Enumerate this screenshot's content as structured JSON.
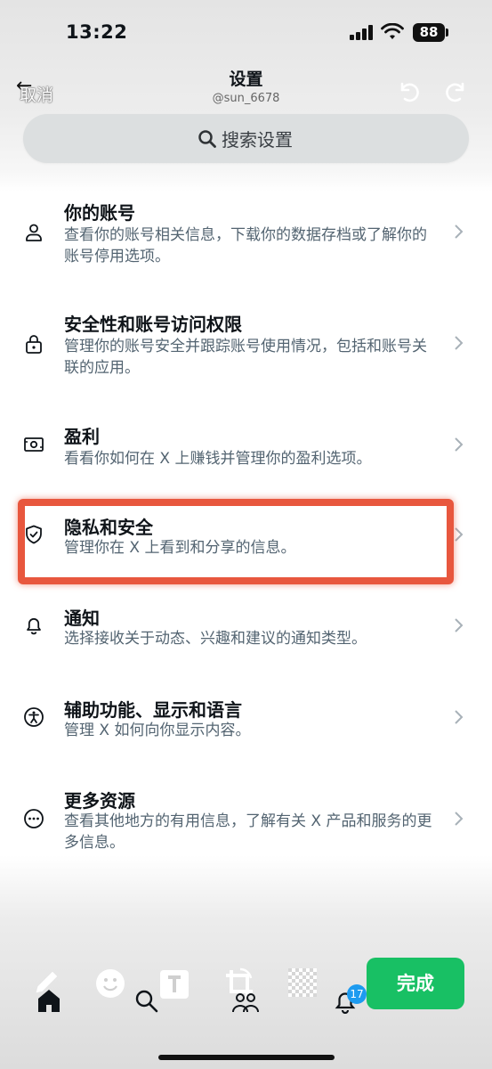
{
  "status": {
    "time": "13:22",
    "battery": "88"
  },
  "header": {
    "cancel_label": "取消",
    "title": "设置",
    "handle": "@sun_6678"
  },
  "search": {
    "placeholder": "搜索设置"
  },
  "items": [
    {
      "title": "你的账号",
      "desc": "查看你的账号相关信息，下载你的数据存档或了解你的账号停用选项。",
      "icon": "person-icon"
    },
    {
      "title": "安全性和账号访问权限",
      "desc": "管理你的账号安全并跟踪账号使用情况，包括和账号关联的应用。",
      "icon": "lock-icon"
    },
    {
      "title": "盈利",
      "desc": "看看你如何在 X 上赚钱并管理你的盈利选项。",
      "icon": "money-icon"
    },
    {
      "title": "隐私和安全",
      "desc": "管理你在 X 上看到和分享的信息。",
      "icon": "shield-icon"
    },
    {
      "title": "通知",
      "desc": "选择接收关于动态、兴趣和建议的通知类型。",
      "icon": "bell-icon"
    },
    {
      "title": "辅助功能、显示和语言",
      "desc": "管理 X 如何向你显示内容。",
      "icon": "accessibility-icon"
    },
    {
      "title": "更多资源",
      "desc": "查看其他地方的有用信息，了解有关 X 产品和服务的更多信息。",
      "icon": "more-icon"
    }
  ],
  "toolbar": {
    "done_label": "完成",
    "notification_count": "17"
  },
  "colors": {
    "highlight": "#e8573e",
    "done": "#18c064",
    "badge": "#1d9bf0"
  }
}
